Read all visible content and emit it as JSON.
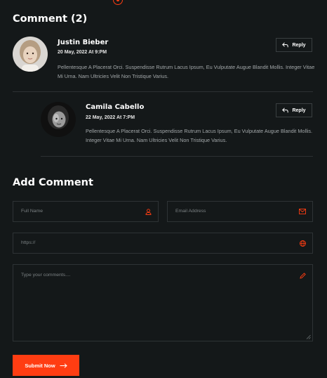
{
  "comments_section": {
    "title": "Comment (2)",
    "items": [
      {
        "name": "Justin Bieber",
        "date": "20 May, 2022 At 9:PM",
        "text": "Pellentesque A Placerat Orci. Suspendisse Rutrum Lacus Ipsum, Eu Vulputate Augue Blandit Mollis. Integer Vitae Mi Urna. Nam Ultricies Velit Non Tristique Varius.",
        "reply_label": "Reply"
      },
      {
        "name": "Camila Cabello",
        "date": "22 May, 2022 At 7:PM",
        "text": "Pellentesque A Placerat Orci. Suspendisse Rutrum Lacus Ipsum, Eu Vulputate Augue Blandit Mollis. Integer Vitae Mi Urna. Nam Ultricies Velit Non Tristique Varius.",
        "reply_label": "Reply"
      }
    ]
  },
  "form": {
    "title": "Add Comment",
    "full_name_placeholder": "Full Name",
    "email_placeholder": "Email Address",
    "url_placeholder": "https://",
    "comment_placeholder": "Type your comments....",
    "submit_label": "Submit Now"
  },
  "colors": {
    "background": "#141819",
    "accent": "#ff3d12",
    "border": "#2e3335",
    "muted_text": "#a3a8aa"
  },
  "icons": {
    "top": "target-icon",
    "reply": "reply-arrow-icon",
    "name": "user-icon",
    "email": "envelope-icon",
    "url": "globe-icon",
    "comment": "pencil-icon",
    "submit": "arrow-right-icon"
  }
}
